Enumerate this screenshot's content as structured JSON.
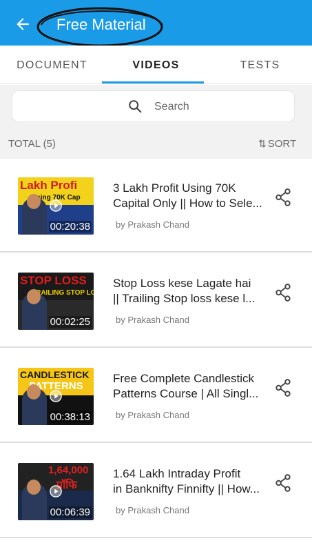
{
  "appbar": {
    "title": "Free Material",
    "back_icon": "back-arrow-icon",
    "color": "#1a9be8"
  },
  "tabs": [
    {
      "label": "DOCUMENT",
      "selected": false
    },
    {
      "label": "VIDEOS",
      "selected": true
    },
    {
      "label": "TESTS",
      "selected": false
    }
  ],
  "search": {
    "placeholder": "Search",
    "icon": "search-icon"
  },
  "list_header": {
    "total": "TOTAL (5)",
    "sort": "SORT",
    "sort_icon": "sort-arrows-icon"
  },
  "videos": [
    {
      "title_line1": "3 Lakh Profit Using 70K",
      "title_line2": "Capital Only || How to Sele...",
      "author": "by Prakash Chand",
      "duration": "00:20:38",
      "thumb_text": "Lakh Profi",
      "thumb_sub": "Using 70K Cap",
      "thumb_top_color": "#f2d21b",
      "thumb_text_color": "#d11a1a",
      "thumb_bottom_color": "#1f3f8a"
    },
    {
      "title_line1": "Stop Loss kese Lagate hai",
      "title_line2": "|| Trailing Stop loss kese l...",
      "author": "by Prakash Chand",
      "duration": "00:02:25",
      "thumb_text": "STOP LOSS",
      "thumb_sub": "TRAILING STOP LO",
      "thumb_top_color": "#1a1a1a",
      "thumb_text_color": "#e31b1b",
      "thumb_bottom_color": "#2a2a2a"
    },
    {
      "title_line1": "Free Complete Candlestick",
      "title_line2": "Patterns Course | All Singl...",
      "author": "by Prakash Chand",
      "duration": "00:38:13",
      "thumb_text": "CANDLESTICK",
      "thumb_sub": "PATTERNS",
      "thumb_top_color": "#f5c518",
      "thumb_text_color": "#1a1a1a",
      "thumb_bottom_color": "#111111"
    },
    {
      "title_line1": "1.64 Lakh Intraday Profit",
      "title_line2": "in Banknifty Finnifty || How...",
      "author": "by Prakash Chand",
      "duration": "00:06:39",
      "thumb_text": "1,64,000",
      "thumb_sub": "प्रॉफि",
      "thumb_top_color": "#222222",
      "thumb_text_color": "#e02020",
      "thumb_bottom_color": "#1b2a4a"
    }
  ],
  "share_icon": "share-icon",
  "play_icon": "play-icon"
}
